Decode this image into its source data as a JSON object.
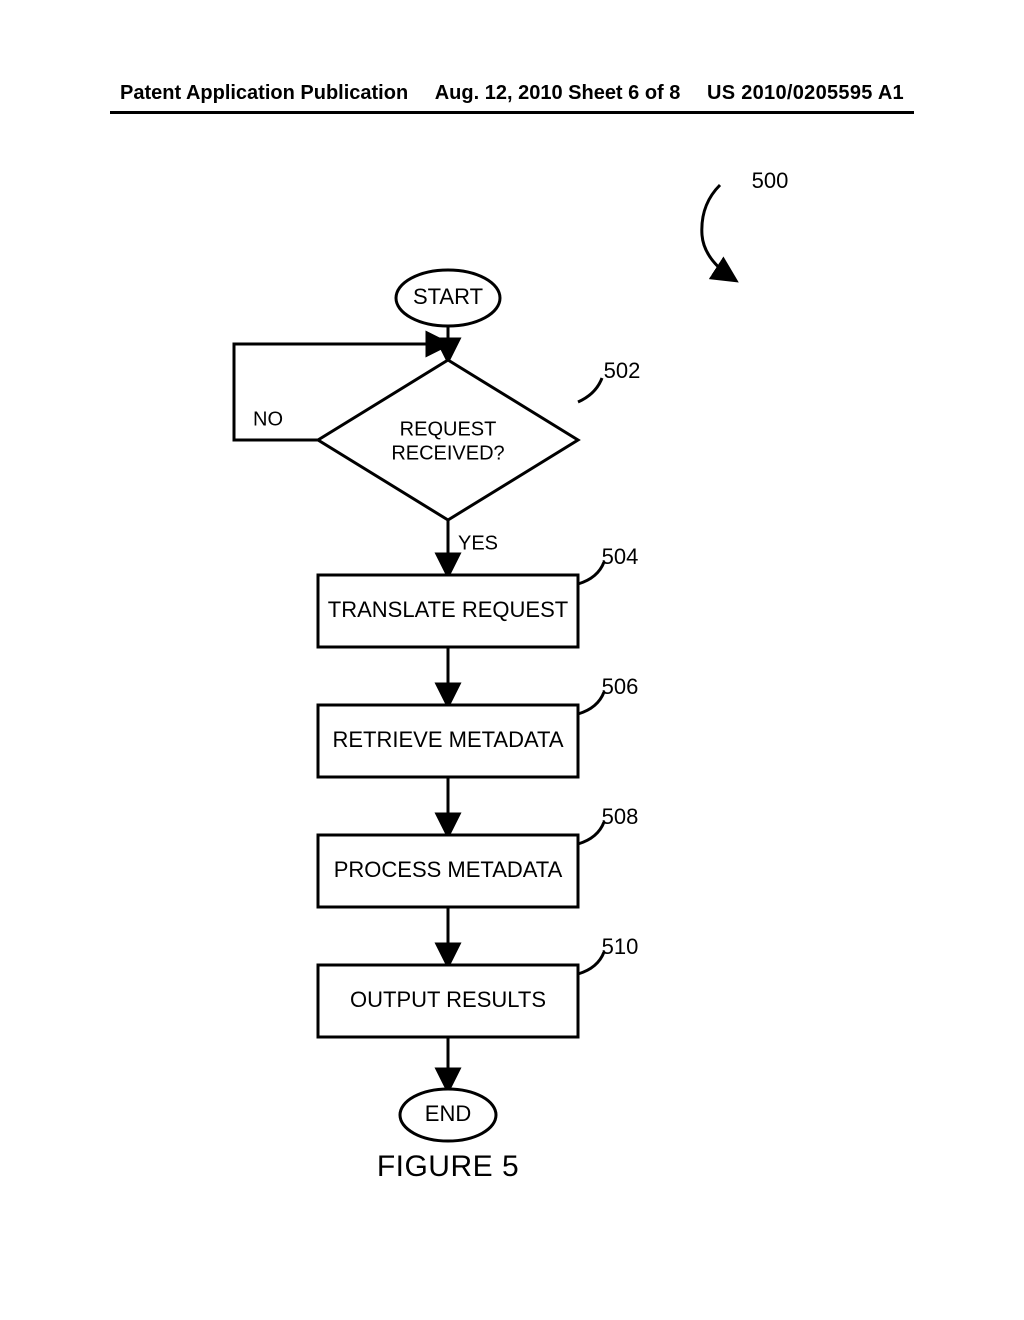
{
  "header": {
    "left": "Patent Application Publication",
    "mid": "Aug. 12, 2010  Sheet 6 of 8",
    "right": "US 2010/0205595 A1"
  },
  "labels": {
    "start": "START",
    "end": "END",
    "yes": "YES",
    "no": "NO",
    "figure": "FIGURE 5",
    "flowref": "500"
  },
  "decision": {
    "line1": "REQUEST",
    "line2": "RECEIVED?"
  },
  "boxes": {
    "translate": "TRANSLATE REQUEST",
    "retrieve": "RETRIEVE METADATA",
    "process": "PROCESS METADATA",
    "output": "OUTPUT RESULTS"
  },
  "refs": {
    "decision": "502",
    "translate": "504",
    "retrieve": "506",
    "process": "508",
    "output": "510"
  }
}
